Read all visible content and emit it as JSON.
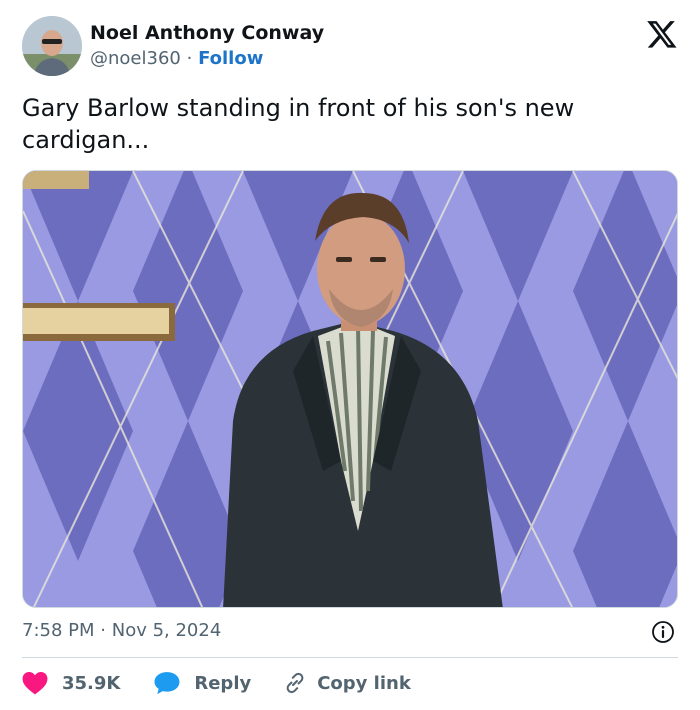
{
  "author": {
    "name": "Noel Anthony Conway",
    "handle": "@noel360",
    "separator": "·",
    "follow_label": "Follow",
    "avatar_icon": "avatar"
  },
  "brand_icon": "x-logo-icon",
  "tweet": {
    "text": "Gary Barlow standing in front of his son's new cardigan...",
    "media_description_icon": "photo"
  },
  "meta": {
    "time": "7:58 PM",
    "separator": "·",
    "date": "Nov 5, 2024",
    "info_icon": "info-icon"
  },
  "actions": {
    "like_count": "35.9K",
    "reply_label": "Reply",
    "copy_label": "Copy link"
  },
  "colors": {
    "accent": "#1d74c8",
    "like": "#f91880",
    "reply": "#1d9bf0",
    "muted": "#536471",
    "text": "#0f1419"
  }
}
